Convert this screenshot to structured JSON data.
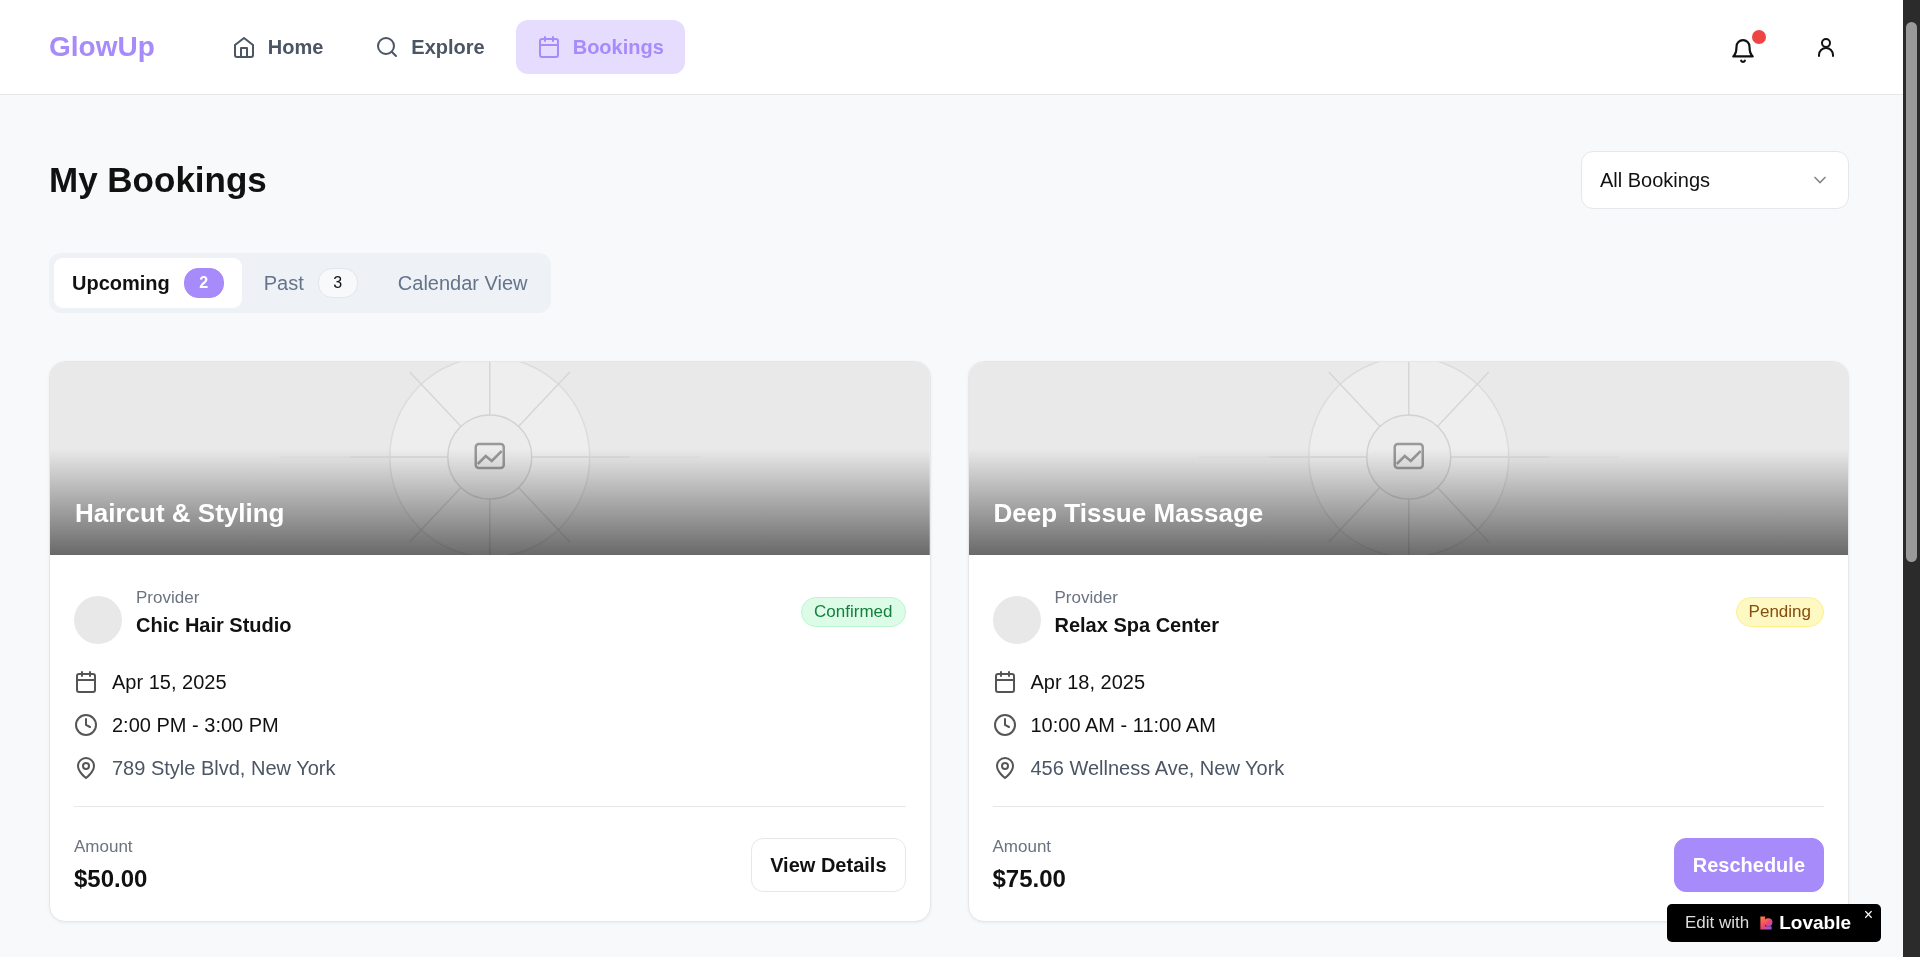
{
  "header": {
    "logo": "GlowUp",
    "nav": [
      {
        "label": "Home",
        "kind": "home",
        "selected": false
      },
      {
        "label": "Explore",
        "kind": "explore",
        "selected": false
      },
      {
        "label": "Bookings",
        "kind": "bookings",
        "selected": true
      }
    ],
    "notifications": {
      "unread": true
    }
  },
  "page": {
    "title": "My Bookings",
    "filter": {
      "value": "All Bookings"
    }
  },
  "tabs": [
    {
      "label": "Upcoming",
      "count": "2",
      "selected": true
    },
    {
      "label": "Past",
      "count": "3",
      "selected": false
    },
    {
      "label": "Calendar View",
      "selected": false
    }
  ],
  "bookings": [
    {
      "service": "Haircut & Styling",
      "provider_label": "Provider",
      "provider": "Chic Hair Studio",
      "status": {
        "label": "Confirmed",
        "kind": "confirmed"
      },
      "date": "Apr 15, 2025",
      "time": "2:00 PM - 3:00 PM",
      "address": "789 Style Blvd, New York",
      "amount_label": "Amount",
      "amount": "$50.00",
      "action": {
        "label": "View Details",
        "kind": "outline"
      }
    },
    {
      "service": "Deep Tissue Massage",
      "provider_label": "Provider",
      "provider": "Relax Spa Center",
      "status": {
        "label": "Pending",
        "kind": "pending"
      },
      "date": "Apr 18, 2025",
      "time": "10:00 AM - 11:00 AM",
      "address": "456 Wellness Ave, New York",
      "amount_label": "Amount",
      "amount": "$75.00",
      "action": {
        "label": "Reschedule",
        "kind": "primary"
      }
    }
  ],
  "edit_badge": {
    "prefix": "Edit with",
    "brand": "Lovable",
    "close": "×"
  }
}
